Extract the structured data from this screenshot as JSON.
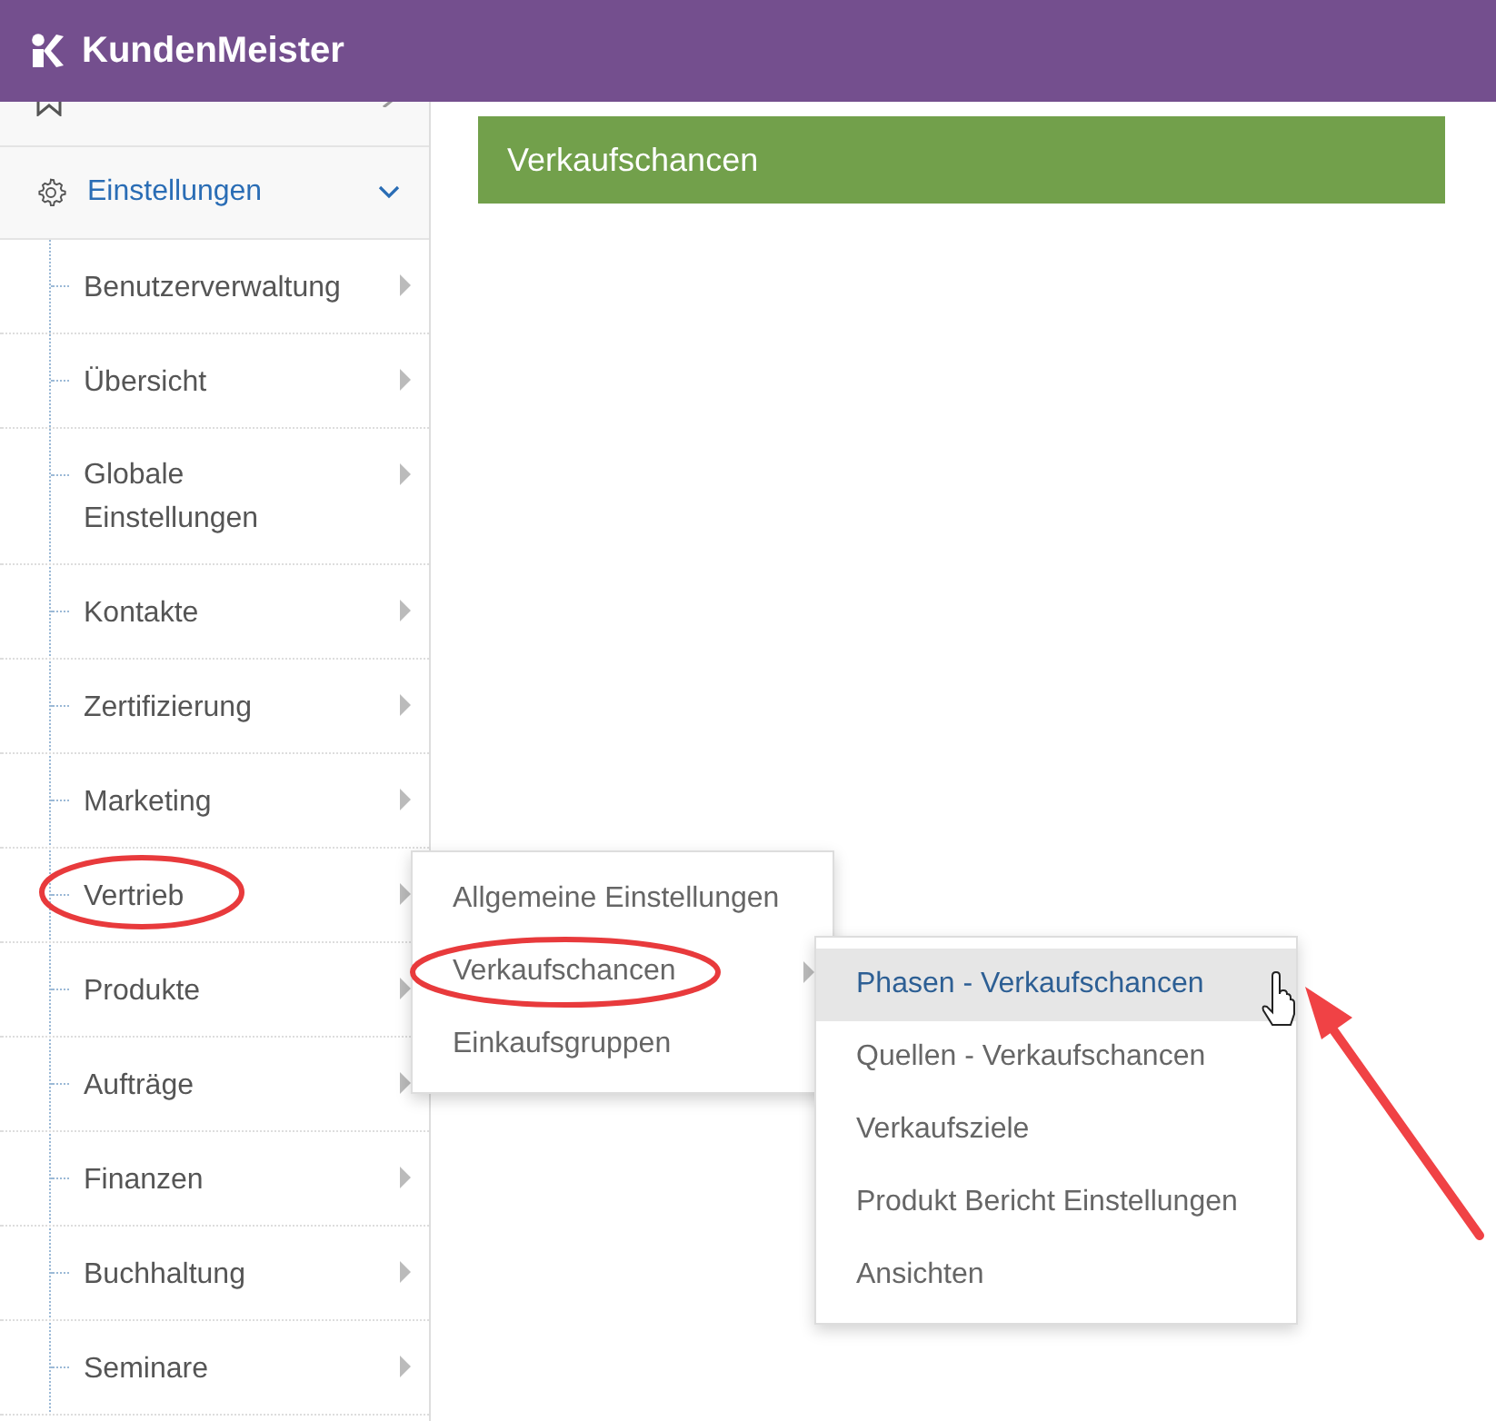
{
  "header": {
    "logo_text": "KundenMeister"
  },
  "sidebar": {
    "sections": [
      {
        "expanded": false
      },
      {
        "label": "Einstellungen",
        "expanded": true,
        "children": [
          {
            "label": "Benutzerverwaltung"
          },
          {
            "label": "Übersicht"
          },
          {
            "label": "Globale Einstellungen"
          },
          {
            "label": "Kontakte"
          },
          {
            "label": "Zertifizierung"
          },
          {
            "label": "Marketing"
          },
          {
            "label": "Vertrieb",
            "children": [
              {
                "label": "Allgemeine Einstellungen"
              },
              {
                "label": "Verkaufschancen",
                "children": [
                  {
                    "label": "Phasen - Verkaufschancen",
                    "selected": true
                  },
                  {
                    "label": "Quellen - Verkaufschancen",
                    "selected": false
                  },
                  {
                    "label": "Verkaufsziele",
                    "selected": false
                  },
                  {
                    "label": "Produkt Bericht Einstellungen",
                    "selected": false
                  },
                  {
                    "label": "Ansichten",
                    "selected": false
                  }
                ]
              },
              {
                "label": "Einkaufsgruppen"
              }
            ]
          },
          {
            "label": "Produkte"
          },
          {
            "label": "Aufträge"
          },
          {
            "label": "Finanzen"
          },
          {
            "label": "Buchhaltung"
          },
          {
            "label": "Seminare"
          }
        ]
      }
    ]
  },
  "main": {
    "title": "Verkaufschancen"
  }
}
